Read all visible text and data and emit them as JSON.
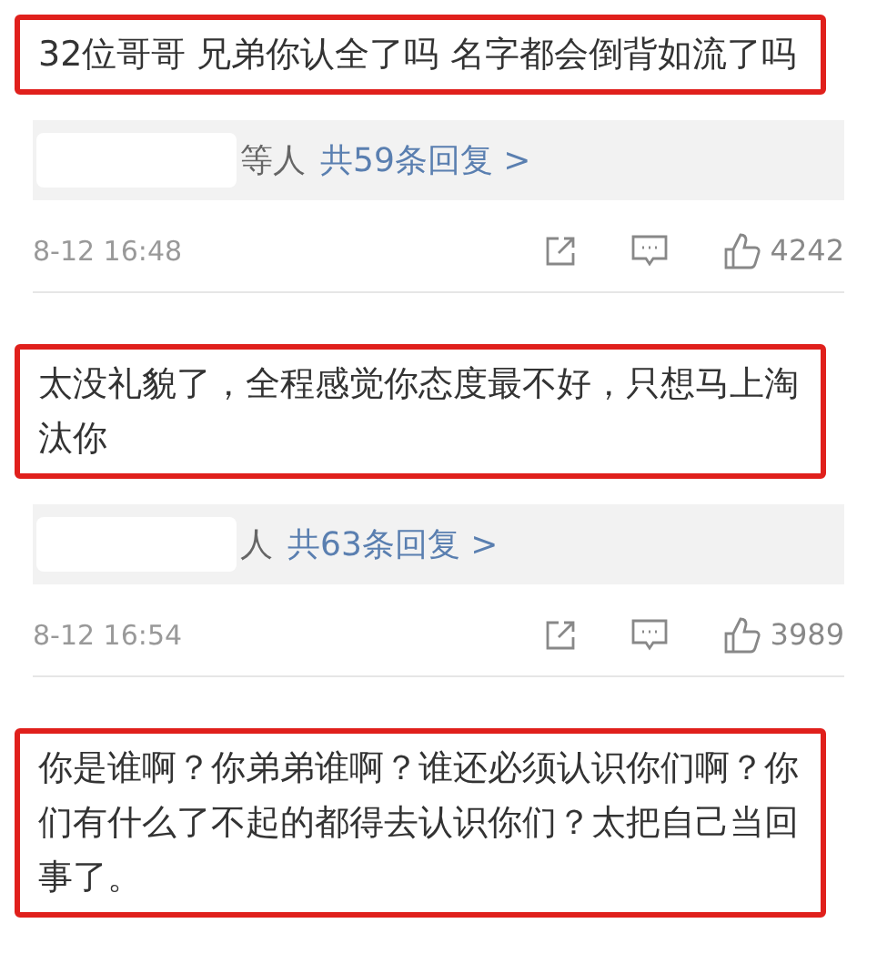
{
  "comments": [
    {
      "text": "32位哥哥 兄弟你认全了吗 名字都会倒背如流了吗",
      "highlighted": true,
      "replies": {
        "names": "等人",
        "link": "共59条回复 >"
      },
      "time": "8-12 16:48",
      "likes": "4242"
    },
    {
      "text": "太没礼貌了，全程感觉你态度最不好，只想马上淘汰你",
      "highlighted": true,
      "replies": {
        "names": "人",
        "link": "共63条回复 >"
      },
      "time": "8-12 16:54",
      "likes": "3989"
    },
    {
      "text": "你是谁啊？你弟弟谁啊？谁还必须认识你们啊？你们有什么了不起的都得去认识你们？太把自己当回事了。",
      "highlighted": true
    }
  ]
}
